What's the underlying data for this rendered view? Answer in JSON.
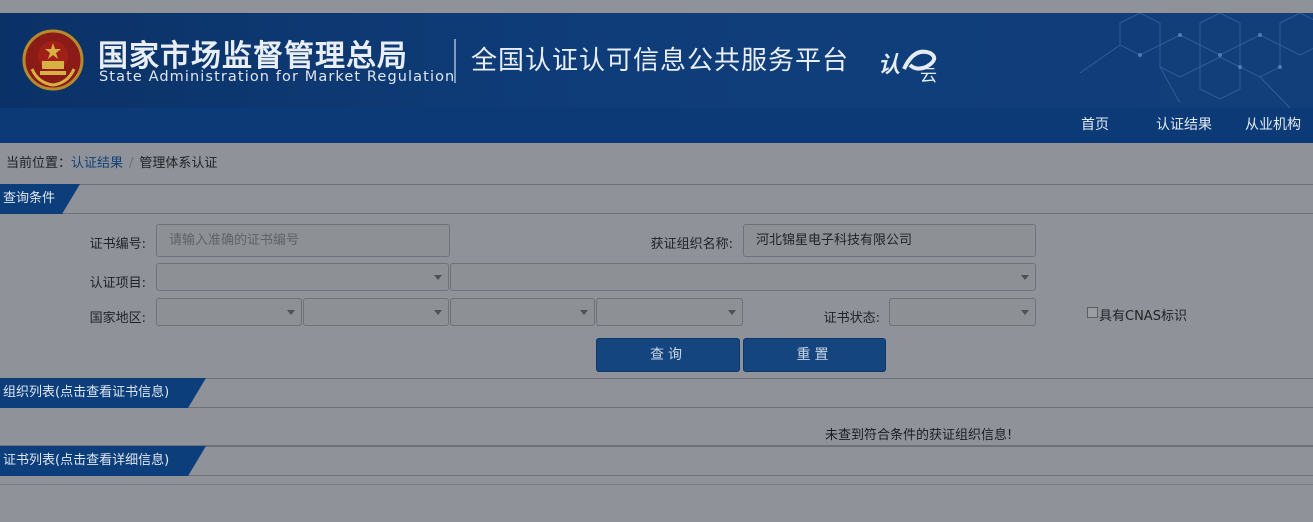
{
  "header": {
    "agency_cn": "国家市场监督管理总局",
    "agency_en": "State Administration  for  Market Regulation",
    "platform": "全国认证认可信息公共服务平台",
    "logo_rz": "认",
    "logo_yun": "云",
    "emblem_icon": "national-emblem-icon"
  },
  "nav": {
    "items": [
      "首页",
      "认证结果",
      "从业机构"
    ]
  },
  "breadcrumb": {
    "prefix": "当前位置：",
    "link": "认证结果",
    "separator": "/",
    "current": "管理体系认证"
  },
  "query": {
    "section_title": "查询条件",
    "cert_no_label": "证书编号:",
    "cert_no_placeholder": "请输入准确的证书编号",
    "org_name_label": "获证组织名称:",
    "org_name_value": "河北锦星电子科技有限公司",
    "project_label": "认证项目:",
    "region_label": "国家地区:",
    "status_label": "证书状态:",
    "cnas_label": "具有CNAS标识",
    "search_button": "查询",
    "reset_button": "重置"
  },
  "org_list": {
    "section_title": "组织列表(点击查看证书信息)",
    "empty_message": "未查到符合条件的获证组织信息!"
  },
  "cert_list": {
    "section_title": "证书列表(点击查看详细信息)"
  },
  "colors": {
    "header_bg": "#0f3d7a",
    "nav_bg": "#0b3a76",
    "section_tab": "#0d3e7c",
    "button_bg": "#15457f"
  }
}
